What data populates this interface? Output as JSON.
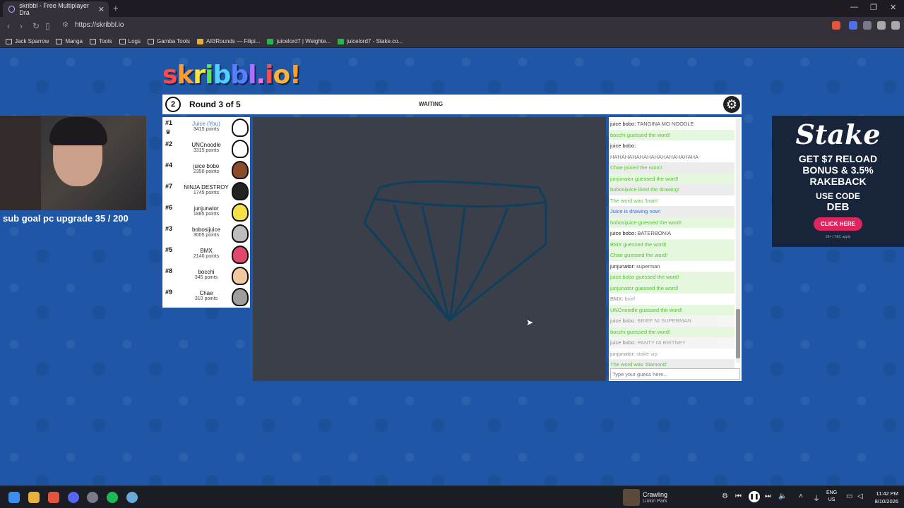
{
  "browser": {
    "tab_title": "skribbl - Free Multiplayer Dra",
    "url": "https://skribbl.io",
    "bookmarks": [
      {
        "label": "Jack Sparrow",
        "icon": "folder-icon"
      },
      {
        "label": "Manga",
        "icon": "folder-icon"
      },
      {
        "label": "Tools",
        "icon": "folder-icon"
      },
      {
        "label": "Logs",
        "icon": "folder-icon"
      },
      {
        "label": "Gamba Tools",
        "icon": "folder-icon"
      },
      {
        "label": "All3Rounds — Filipi...",
        "icon": "yellow-site-icon"
      },
      {
        "label": "juicelord7 | Weighte...",
        "icon": "green-site-icon"
      },
      {
        "label": "juicelord7 - Stake.co...",
        "icon": "green-site-icon"
      }
    ]
  },
  "game": {
    "logo": "skribbl.io",
    "timer": "2",
    "round": "Round 3 of 5",
    "status": "WAITING",
    "players": [
      {
        "rank": "#1",
        "name": "Juice (You)",
        "points": "3415 points",
        "you": true,
        "crown": true,
        "avatar_color": "#ffffff"
      },
      {
        "rank": "#2",
        "name": "UNCnoodle",
        "points": "3315 points",
        "avatar_color": "#ffffff"
      },
      {
        "rank": "#4",
        "name": "juice bobo",
        "points": "2350 points",
        "avatar_color": "#8a4b2a"
      },
      {
        "rank": "#7",
        "name": "NINJA DESTROY",
        "points": "1745 points",
        "avatar_color": "#222222"
      },
      {
        "rank": "#6",
        "name": "junjunator",
        "points": "1885 points",
        "avatar_color": "#f5e04a"
      },
      {
        "rank": "#3",
        "name": "bobosijuice",
        "points": "3005 points",
        "avatar_color": "#bdbdbd"
      },
      {
        "rank": "#5",
        "name": "BMX",
        "points": "2140 points",
        "avatar_color": "#e0496a"
      },
      {
        "rank": "#8",
        "name": "bocchi",
        "points": "345 points",
        "avatar_color": "#f2c8a0"
      },
      {
        "rank": "#9",
        "name": "Chae",
        "points": "310 points",
        "avatar_color": "#9e9e9e"
      }
    ],
    "canvas_color": "#3a3f4a",
    "stroke_color": "#0e3f5e"
  },
  "chat": {
    "messages": [
      {
        "who": "juice bobo:",
        "text": "TANGINA MO NOODLE",
        "style": "chat",
        "alt": false
      },
      {
        "text": "bocchi guessed the word!",
        "style": "guess"
      },
      {
        "who": "juice bobo:",
        "text": "",
        "style": "chat",
        "alt": false
      },
      {
        "text": "HAHAHAHAHAHAHAHAHAHAHAHA",
        "style": "faded",
        "alt": false
      },
      {
        "text": "Chae joined the room!",
        "style": "green",
        "alt": true
      },
      {
        "text": "junjunator guessed the word!",
        "style": "guess"
      },
      {
        "text": "bobosijuice liked the drawing!",
        "style": "green",
        "alt": true
      },
      {
        "text": "The word was 'brain'",
        "style": "green",
        "alt": false
      },
      {
        "text": "Juice is drawing now!",
        "style": "blue",
        "alt": true
      },
      {
        "text": "bobosijuice guessed the word!",
        "style": "guess"
      },
      {
        "who": "juice bobo:",
        "text": "BATERBONIA",
        "style": "chat",
        "alt": false
      },
      {
        "text": "BMX guessed the word!",
        "style": "guess"
      },
      {
        "text": "Chae guessed the word!",
        "style": "guess"
      },
      {
        "who": "junjunator:",
        "text": "superman",
        "style": "chat",
        "alt": false
      },
      {
        "text": "juice bobo guessed the word!",
        "style": "guess"
      },
      {
        "text": "junjunator guessed the word!",
        "style": "guess"
      },
      {
        "who": "BMX:",
        "text": "brief",
        "style": "chatfaded",
        "alt": false
      },
      {
        "text": "UNCnoodle guessed the word!",
        "style": "guess"
      },
      {
        "who": "juice bobo:",
        "text": "BRIEF NI SUPERMAN",
        "style": "chatfaded",
        "alt": true
      },
      {
        "text": "bocchi guessed the word!",
        "style": "guess"
      },
      {
        "who": "juice bobo:",
        "text": "PANTY NI BRITNEY",
        "style": "chatfaded",
        "alt": true
      },
      {
        "who": "junjunator:",
        "text": "stake vip",
        "style": "chatfaded",
        "alt": false
      },
      {
        "text": "The word was 'diamond'",
        "style": "green",
        "alt": true
      }
    ],
    "input_placeholder": "Type your guess here..."
  },
  "overlay": {
    "subgoal": "sub goal pc upgrade 35 / 200"
  },
  "ad": {
    "brand": "Stake",
    "offer_line1": "GET $7 RELOAD",
    "offer_line2": "BONUS & 3.5%",
    "offer_line3": "RAKEBACK",
    "code_label": "USE CODE",
    "code": "DEB",
    "cta": "CLICK HERE",
    "fine": "18+ | T&C apply"
  },
  "taskbar": {
    "song": "Crawling",
    "artist": "Linkin Park",
    "lang1": "ENG",
    "lang2": "US",
    "time": "11:42 PM",
    "date": "8/10/2026"
  }
}
